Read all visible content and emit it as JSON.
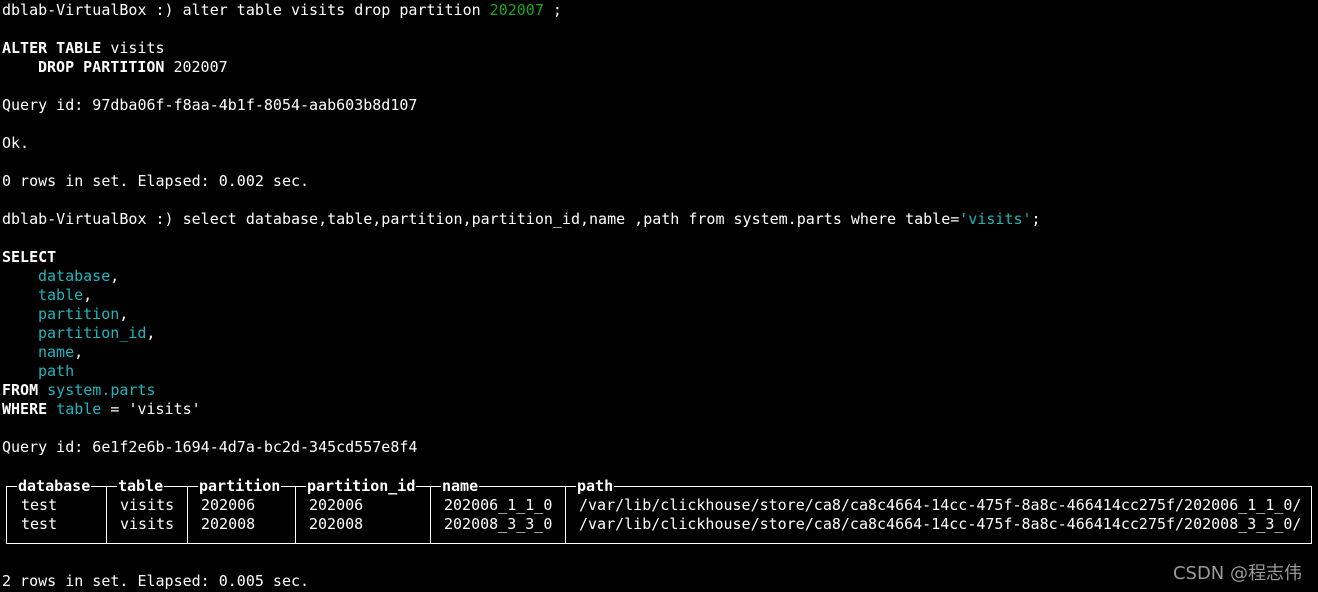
{
  "terminal": {
    "prompt": "dblab-VirtualBox :) ",
    "cmd1": {
      "pre": "alter table visits drop partition ",
      "value": "202007",
      "post": " ;"
    },
    "echo1": {
      "kw1": "ALTER TABLE",
      "rest1": " visits",
      "kw2": "DROP PARTITION",
      "rest2": " 202007"
    },
    "query_id_1": "Query id: 97dba06f-f8aa-4b1f-8054-aab603b8d107",
    "ok": "Ok.",
    "elapsed_1": "0 rows in set. Elapsed: 0.002 sec.",
    "cmd2": {
      "pre": "select database,table,partition,partition_id,name ,path from system.parts where table=",
      "value": "'visits'",
      "post": ";"
    },
    "echo2": {
      "select_kw": "SELECT",
      "fields": [
        "database",
        "table",
        "partition",
        "partition_id",
        "name",
        "path"
      ],
      "comma": ",",
      "from_kw": "FROM",
      "from_table": "system.parts",
      "where_kw": "WHERE",
      "where_col": "table",
      "where_op": " = ",
      "where_val": "'visits'"
    },
    "query_id_2": "Query id: 6e1f2e6b-1694-4d7a-bc2d-345cd557e8f4",
    "elapsed_2": "2 rows in set. Elapsed: 0.005 sec."
  },
  "result_table": {
    "columns": [
      "database",
      "table",
      "partition",
      "partition_id",
      "name",
      "path"
    ],
    "rows": [
      [
        "test",
        "visits",
        "202006",
        "202006",
        "202006_1_1_0",
        "/var/lib/clickhouse/store/ca8/ca8c4664-14cc-475f-8a8c-466414cc275f/202006_1_1_0/"
      ],
      [
        "test",
        "visits",
        "202008",
        "202008",
        "202008_3_3_0",
        "/var/lib/clickhouse/store/ca8/ca8c4664-14cc-475f-8a8c-466414cc275f/202008_3_3_0/"
      ]
    ]
  },
  "watermark": "CSDN @程志伟",
  "colors": {
    "background": "#000000",
    "text": "#ffffff",
    "identifier": "#1ab8bf",
    "number_literal": "#1aa81a"
  }
}
